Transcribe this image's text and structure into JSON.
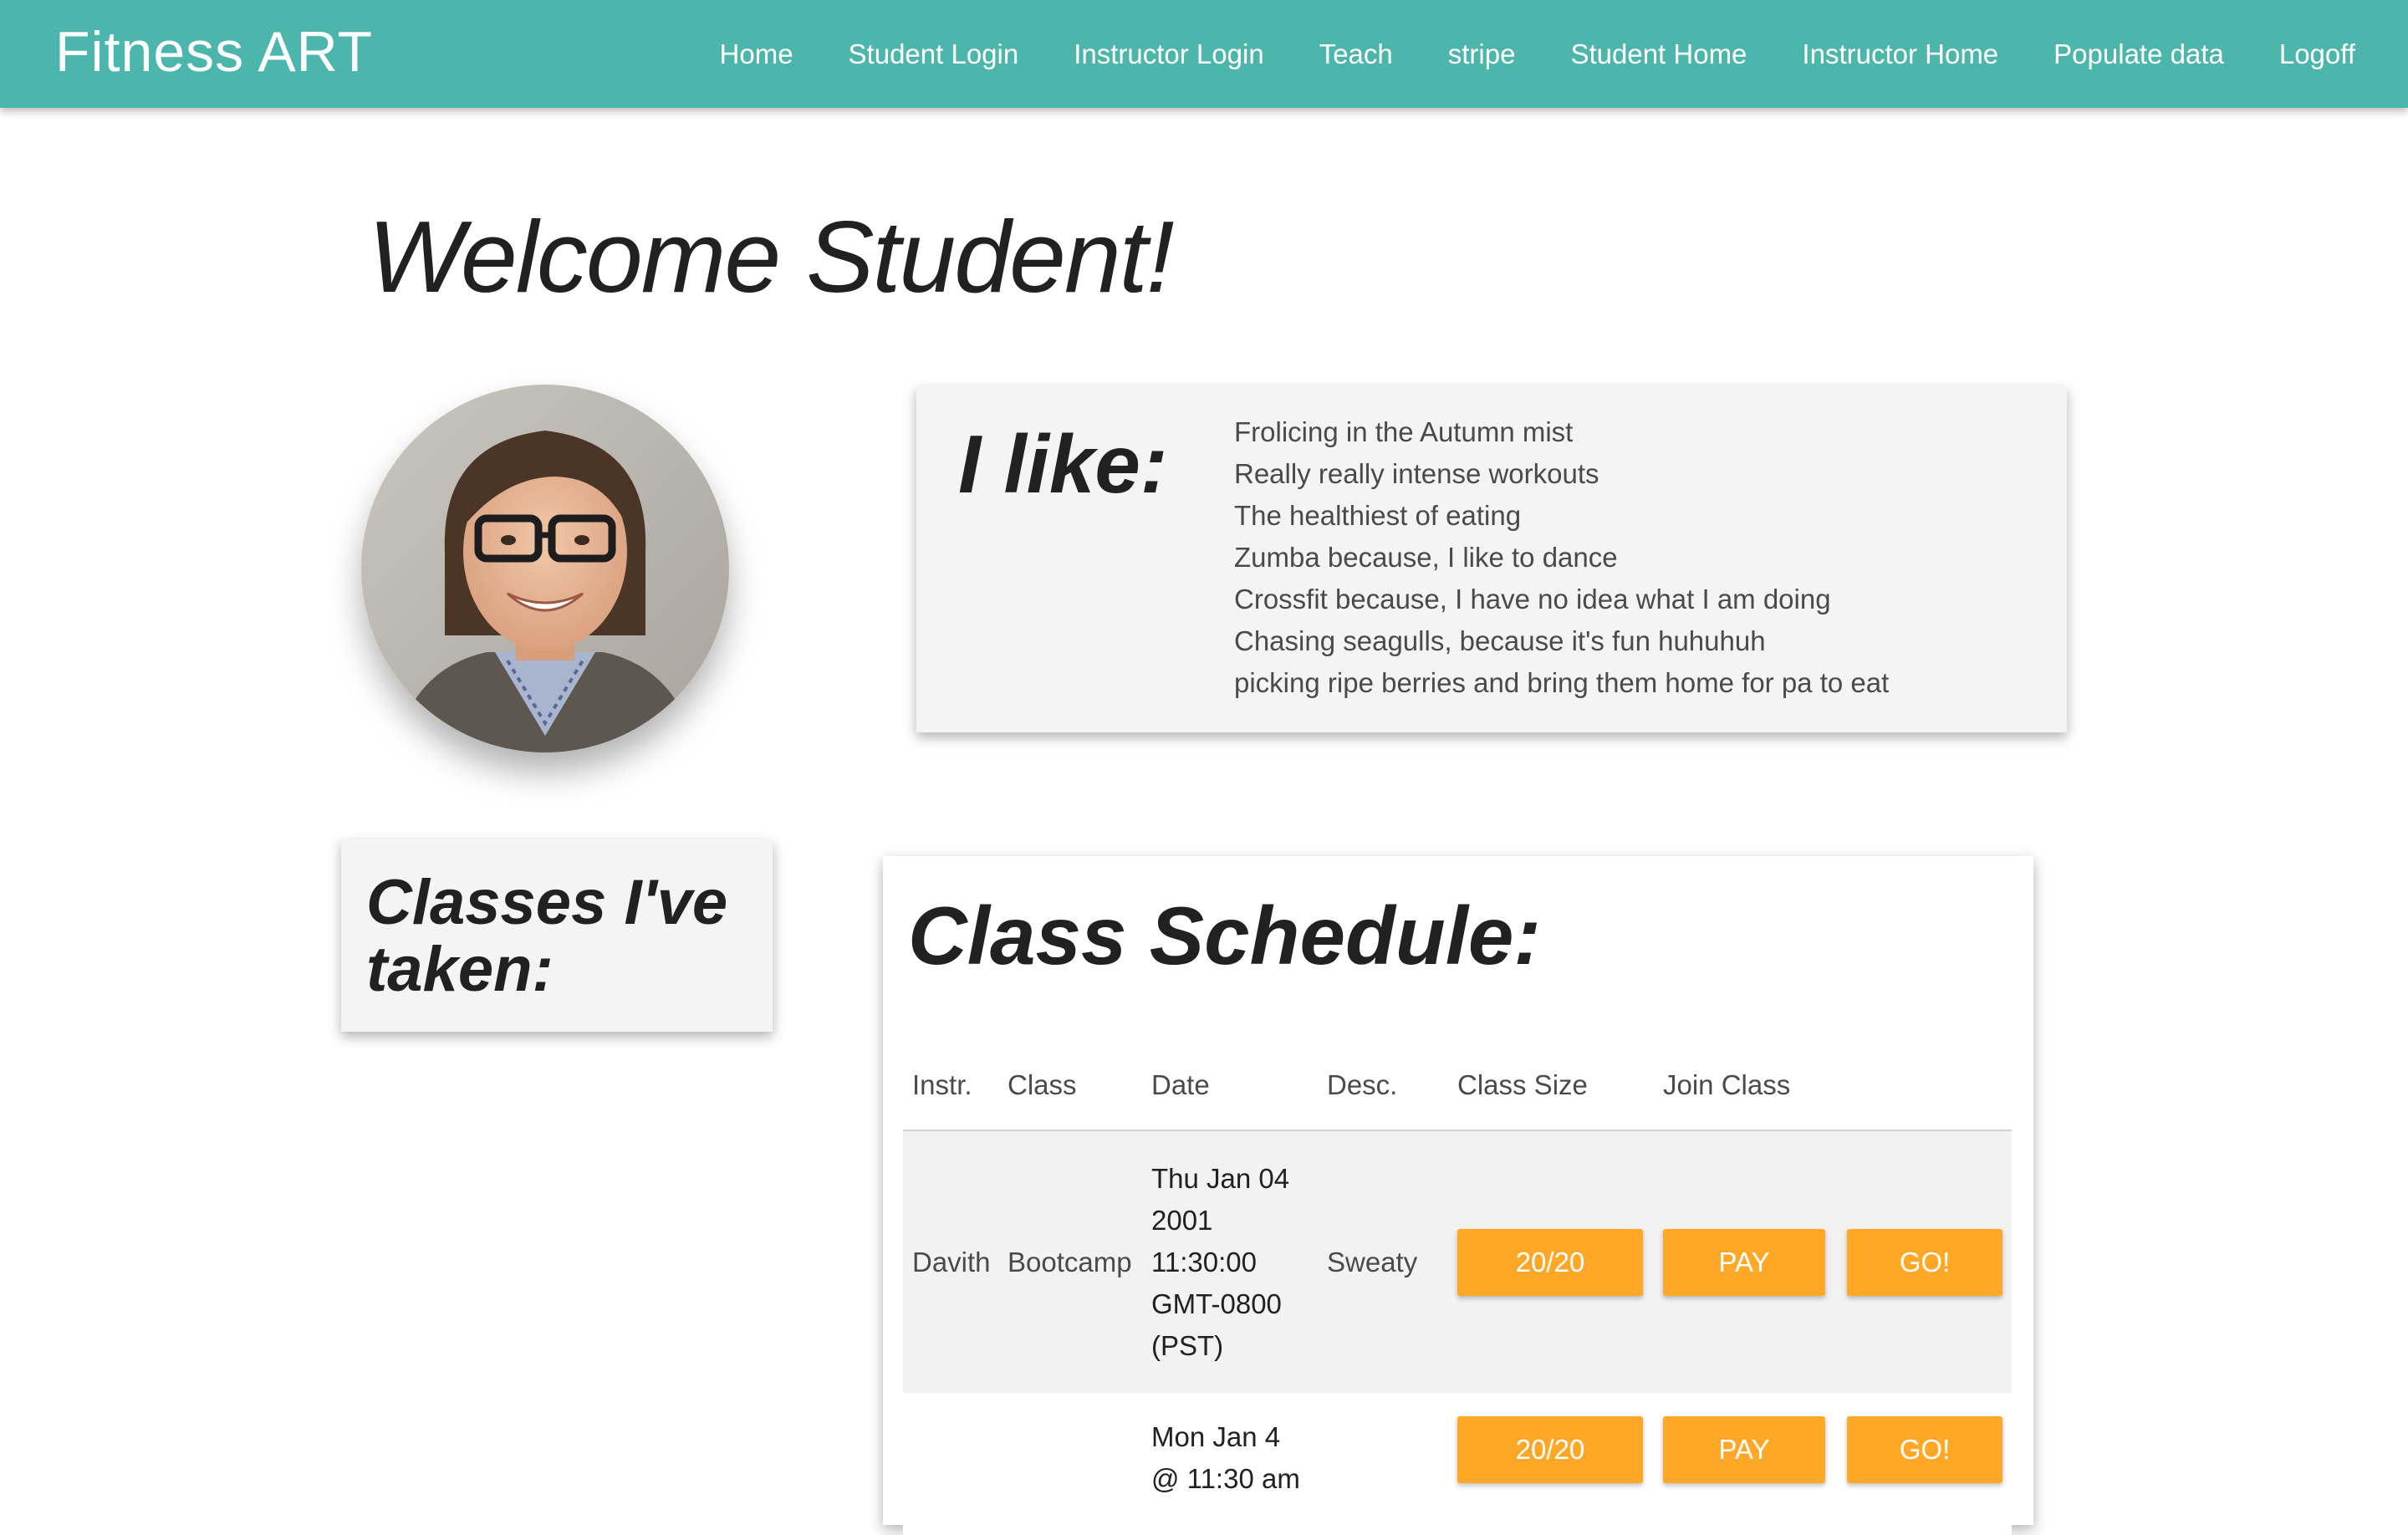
{
  "brand": "Fitness ART",
  "nav": {
    "items": [
      "Home",
      "Student Login",
      "Instructor Login",
      "Teach",
      "stripe",
      "Student Home",
      "Instructor Home",
      "Populate data",
      "Logoff"
    ]
  },
  "page": {
    "title": "Welcome Student!"
  },
  "likes": {
    "title": "I like:",
    "items": [
      "Frolicing in the Autumn mist",
      "Really really intense workouts",
      "The healthiest of eating",
      "Zumba because, I like to dance",
      "Crossfit because, I have no idea what I am doing",
      "Chasing seagulls, because it's fun huhuhuh",
      "picking ripe berries and bring them home for pa to eat"
    ]
  },
  "classes_taken": {
    "title": "Classes I've taken:"
  },
  "schedule": {
    "title": "Class Schedule:",
    "headers": [
      "Instr.",
      "Class",
      "Date",
      "Desc.",
      "Class Size",
      "Join Class"
    ],
    "rows": [
      {
        "instructor": "Davith",
        "class": "Bootcamp",
        "date_lines": [
          "Thu Jan 04",
          "2001",
          "11:30:00",
          "GMT-0800",
          "(PST)"
        ],
        "desc": "Sweaty",
        "size": "20/20",
        "pay_label": "PAY",
        "go_label": "GO!"
      },
      {
        "instructor": "",
        "class": "",
        "date_lines": [
          "Mon Jan 4",
          "@ 11:30 am"
        ],
        "desc": "",
        "size": "20/20",
        "pay_label": "PAY",
        "go_label": "GO!"
      }
    ]
  },
  "colors": {
    "nav_bg": "#4db6ac",
    "button_bg": "#ffa726",
    "card_bg": "#f4f4f4"
  }
}
